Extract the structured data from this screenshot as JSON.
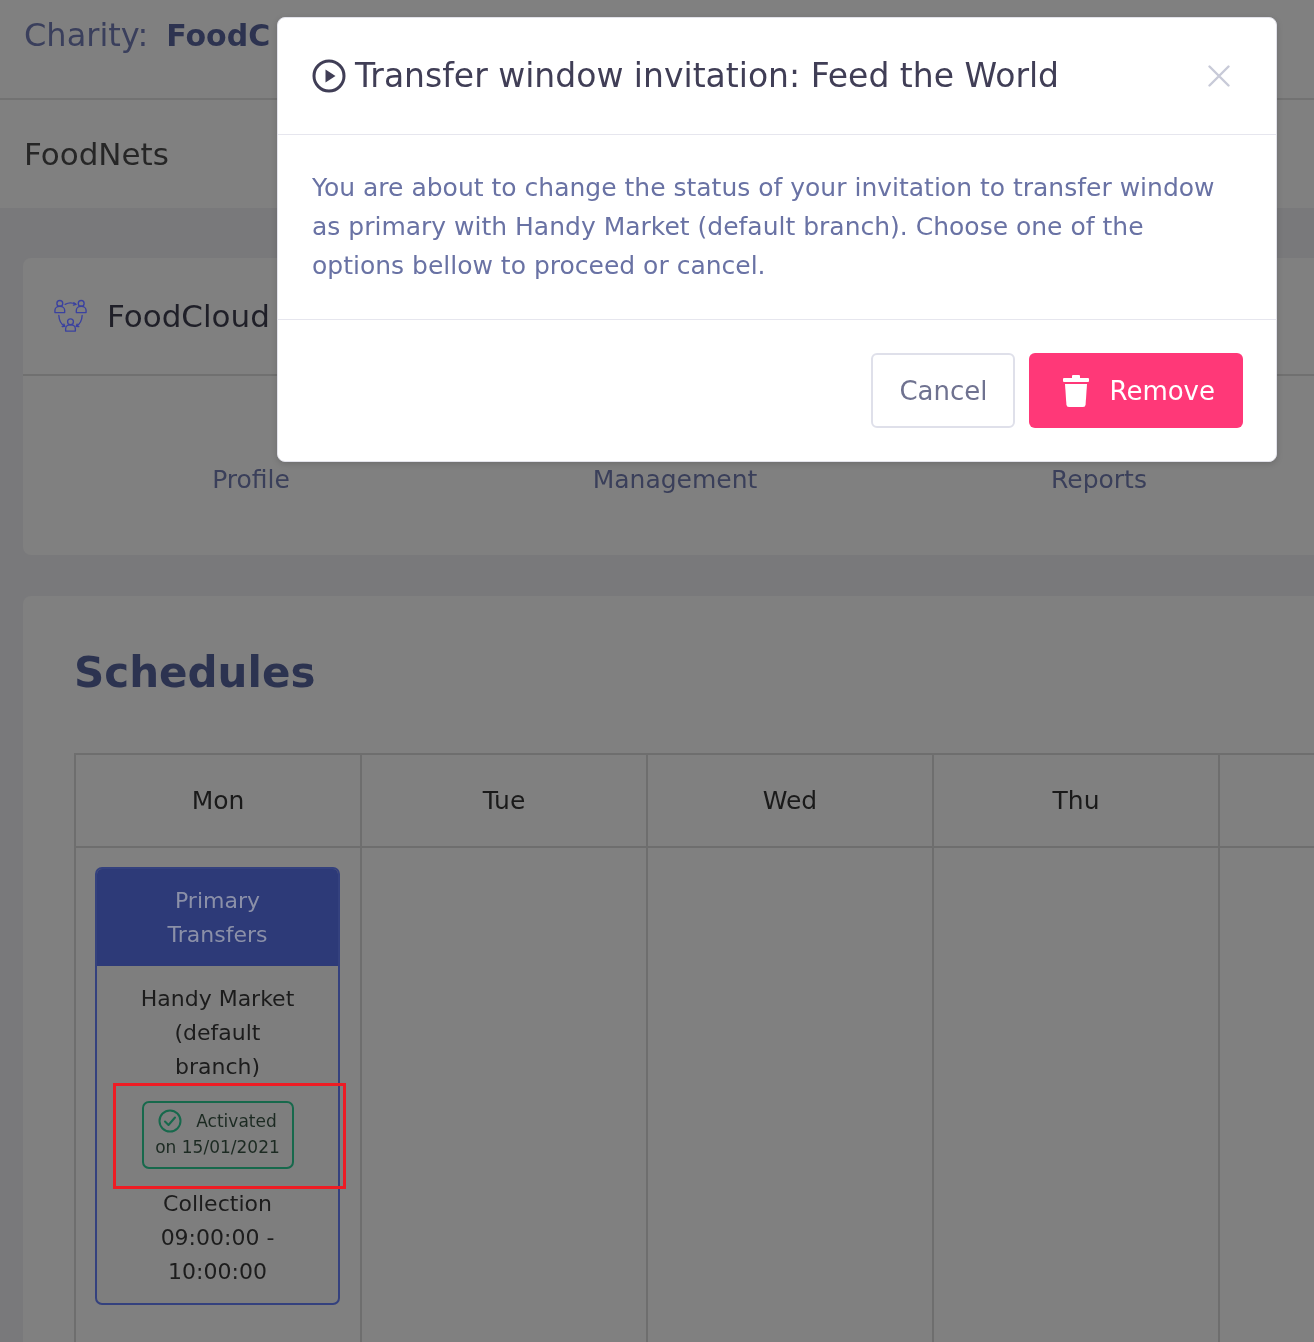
{
  "header": {
    "label": "Charity:",
    "charity": "FoodC"
  },
  "nav": {
    "brand": "FoodNets"
  },
  "organization": {
    "name": "FoodCloud",
    "links": [
      {
        "label": "Profile"
      },
      {
        "label": "Management"
      },
      {
        "label": "Reports"
      }
    ]
  },
  "schedules": {
    "title": "Schedules",
    "days": [
      {
        "label": "Mon",
        "entries": [
          {
            "type": "Primary Transfers",
            "partner": "Handy Market (default branch)",
            "status": {
              "text": "Activated",
              "date": "on 15/01/2021",
              "activated": true,
              "highlighted": true
            },
            "time": "Collection 09:00:00 - 10:00:00"
          }
        ]
      },
      {
        "label": "Tue"
      },
      {
        "label": "Wed"
      },
      {
        "label": "Thu"
      }
    ]
  },
  "modal": {
    "title": "Transfer window invitation: Feed the World",
    "message": "You are about to change the status of your invitation to transfer window as primary with Handy Market (default branch). Choose one of the options bellow to proceed or cancel.",
    "buttons": [
      {
        "label": "Cancel",
        "kind": "secondary"
      },
      {
        "label": "Remove",
        "kind": "danger"
      }
    ]
  }
}
